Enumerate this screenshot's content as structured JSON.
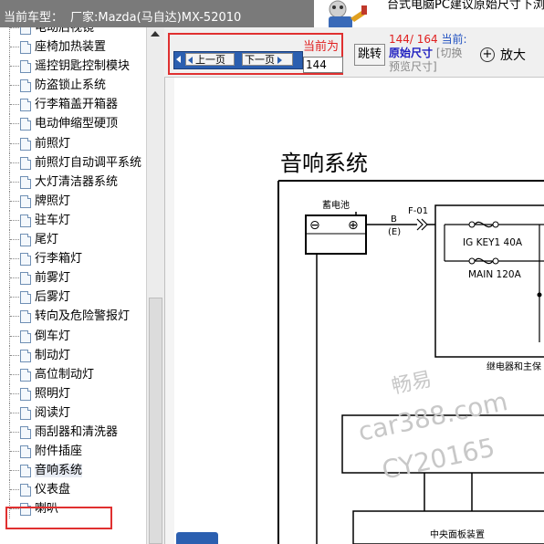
{
  "header": {
    "current_model_label": "当前车型：",
    "manufacturer_model": "厂家:Mazda(马自达)MX-52010",
    "notice_text": "台式电脑PC建议原始尺寸下浏"
  },
  "sidebar": {
    "items": [
      {
        "label": "电动后视镜"
      },
      {
        "label": "座椅加热装置"
      },
      {
        "label": "遥控钥匙控制模块"
      },
      {
        "label": "防盗锁止系统"
      },
      {
        "label": "行李箱盖开箱器"
      },
      {
        "label": "电动伸缩型硬顶"
      },
      {
        "label": "前照灯"
      },
      {
        "label": "前照灯自动调平系统"
      },
      {
        "label": "大灯清洁器系统"
      },
      {
        "label": "牌照灯"
      },
      {
        "label": "驻车灯"
      },
      {
        "label": "尾灯"
      },
      {
        "label": "行李箱灯"
      },
      {
        "label": "前雾灯"
      },
      {
        "label": "后雾灯"
      },
      {
        "label": "转向及危险警报灯"
      },
      {
        "label": "倒车灯"
      },
      {
        "label": "制动灯"
      },
      {
        "label": "高位制动灯"
      },
      {
        "label": "照明灯"
      },
      {
        "label": "阅读灯"
      },
      {
        "label": "雨刮器和清洗器"
      },
      {
        "label": "附件插座"
      },
      {
        "label": "音响系统",
        "selected": true
      },
      {
        "label": "仪表盘"
      },
      {
        "label": "喇叭"
      }
    ]
  },
  "toolbar": {
    "prev_label": "上一页",
    "next_label": "下一页",
    "current_label": "当前为",
    "page_value": "144",
    "jump_label": "跳转",
    "page_count": "144/ 164",
    "current_tag": "当前:",
    "size_label": "原始尺寸",
    "switch_hint": "[切换预览尺寸]",
    "zoom_label": "放大",
    "zoom_symbol": "+"
  },
  "document": {
    "title": "音响系统",
    "battery_label": "蓄电池",
    "minus_symbol": "⊖",
    "plus_symbol": "⊕",
    "wire_b": "B",
    "wire_e": "(E)",
    "connector_label": "F-01",
    "fuse_ig_key": "IG KEY1 40A",
    "fuse_main": "MAIN 120A",
    "relay_box_label": "继电器和主保",
    "center_panel_label": "中央面板装置"
  },
  "watermark": {
    "line1": "畅易",
    "line2": "car388.com",
    "line3": "CY20165"
  },
  "colors": {
    "highlight_border": "#e03030",
    "nav_blue": "#2b5fb0",
    "page_count_red": "#e02020",
    "size_blue": "#2020c0"
  }
}
